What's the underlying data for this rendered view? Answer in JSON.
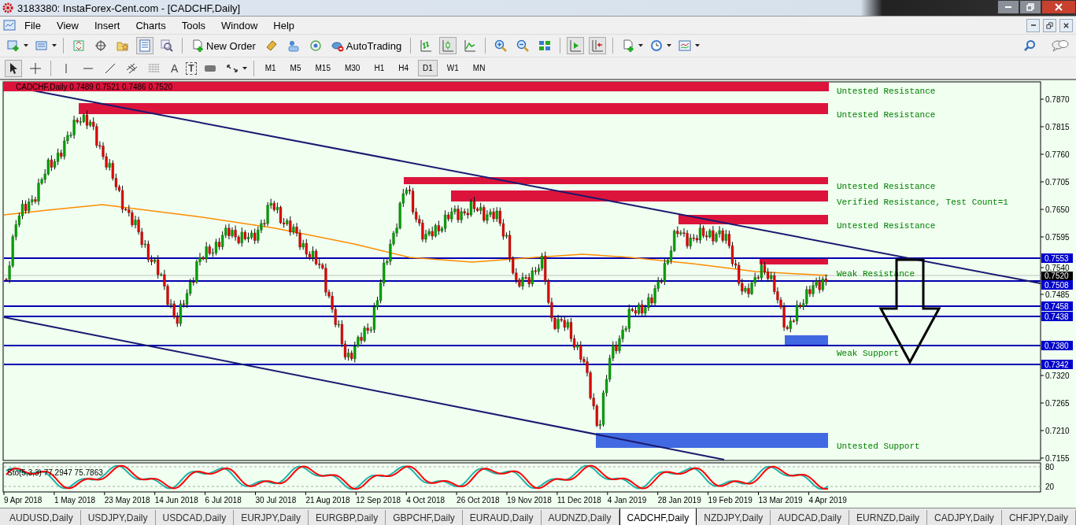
{
  "window": {
    "title": "3183380: InstaForex-Cent.com - [CADCHF,Daily]"
  },
  "menu": [
    "File",
    "View",
    "Insert",
    "Charts",
    "Tools",
    "Window",
    "Help"
  ],
  "toolbar_buttons": [
    {
      "label": "New Order"
    },
    {
      "label": "AutoTrading"
    }
  ],
  "text_tools": [
    "A",
    "T"
  ],
  "timeframes": [
    {
      "label": "M1",
      "selected": false
    },
    {
      "label": "M5",
      "selected": false
    },
    {
      "label": "M15",
      "selected": false
    },
    {
      "label": "M30",
      "selected": false
    },
    {
      "label": "H1",
      "selected": false
    },
    {
      "label": "H4",
      "selected": false
    },
    {
      "label": "D1",
      "selected": true
    },
    {
      "label": "W1",
      "selected": false
    },
    {
      "label": "MN",
      "selected": false
    }
  ],
  "chart": {
    "legend": "CADCHF,Daily  0.7489 0.7521 0.7486 0.7520",
    "zones": [
      {
        "kind": "resistance",
        "label": "Untested Resistance"
      },
      {
        "kind": "resistance",
        "label": "Untested Resistance"
      },
      {
        "kind": "resistance",
        "label": "Untested Resistance"
      },
      {
        "kind": "resistance",
        "label": "Verified Resistance, Test Count=1"
      },
      {
        "kind": "resistance",
        "label": "Untested Resistance"
      },
      {
        "kind": "resistance",
        "label": "Weak Resistance"
      },
      {
        "kind": "support",
        "label": "Weak Support"
      },
      {
        "kind": "support",
        "label": "Untested Support"
      }
    ],
    "price_lines": [
      "0.7553",
      "0.7508",
      "0.7458",
      "0.7438",
      "0.7380",
      "0.7342"
    ],
    "current_price": "0.7520",
    "price_axis": [
      "0.7870",
      "0.7815",
      "0.7760",
      "0.7705",
      "0.7650",
      "0.7595",
      "0.7540",
      "0.7485",
      "0.7320",
      "0.7265",
      "0.7210",
      "0.7155"
    ],
    "indicator": {
      "legend": "Sto(5,3,3) 77.2947 75.7863",
      "levels": [
        "80",
        "20"
      ]
    },
    "date_axis": [
      "9 Apr 2018",
      "1 May 2018",
      "23 May 2018",
      "14 Jun 2018",
      "6 Jul 2018",
      "30 Jul 2018",
      "21 Aug 2018",
      "12 Sep 2018",
      "4 Oct 2018",
      "26 Oct 2018",
      "19 Nov 2018",
      "11 Dec 2018",
      "4 Jan 2019",
      "28 Jan 2019",
      "19 Feb 2019",
      "13 Mar 2019",
      "4 Apr 2019"
    ]
  },
  "tabs": [
    {
      "label": "AUDUSD,Daily",
      "selected": false
    },
    {
      "label": "USDJPY,Daily",
      "selected": false
    },
    {
      "label": "USDCAD,Daily",
      "selected": false
    },
    {
      "label": "EURJPY,Daily",
      "selected": false
    },
    {
      "label": "EURGBP,Daily",
      "selected": false
    },
    {
      "label": "GBPCHF,Daily",
      "selected": false
    },
    {
      "label": "EURAUD,Daily",
      "selected": false
    },
    {
      "label": "AUDNZD,Daily",
      "selected": false
    },
    {
      "label": "CADCHF,Daily",
      "selected": true
    },
    {
      "label": "NZDJPY,Daily",
      "selected": false
    },
    {
      "label": "AUDCAD,Daily",
      "selected": false
    },
    {
      "label": "EURNZD,Daily",
      "selected": false
    },
    {
      "label": "CADJPY,Daily",
      "selected": false
    },
    {
      "label": "CHFJPY,Daily",
      "selected": false
    }
  ]
}
